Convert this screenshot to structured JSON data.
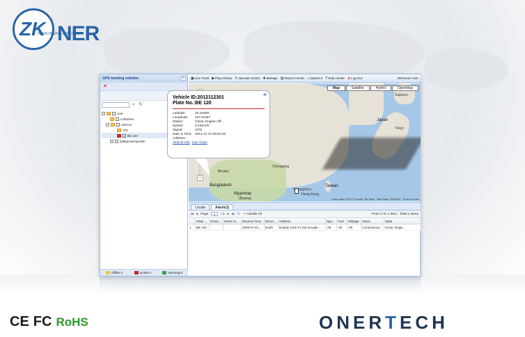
{
  "branding": {
    "logo_zk": "ZK",
    "logo_small": "WWW.ONERALARM.COM",
    "logo_ner": "NER",
    "certs": [
      "CE",
      "FC"
    ],
    "rohs": "RoHS",
    "brand_pre": "ONER",
    "brand_t": "T",
    "brand_post": "ECH"
  },
  "left_panel": {
    "title": "GPS tracking solution",
    "collapse_glyph": "«",
    "delete_glyph": "✕",
    "search_placeholder": "",
    "tree": [
      {
        "label": "oner",
        "level": 0
      },
      {
        "label": "coltracker",
        "level": 1
      },
      {
        "label": "onercar",
        "level": 1
      },
      {
        "label": "123",
        "level": 2
      },
      {
        "label": "BE 120",
        "level": 2
      },
      {
        "label": "ataligrossimporten",
        "level": 1
      }
    ],
    "status": [
      {
        "label": "Offline:1",
        "color": "#f4c542"
      },
      {
        "label": "Online:1",
        "color": "#c8262a"
      },
      {
        "label": "Running:0",
        "color": "#3aa33a"
      }
    ]
  },
  "toolbar": {
    "items": [
      "Live Track",
      "Play History",
      "Operate Centre",
      "Manage",
      "Report Centre",
      "System",
      "Help Center",
      "Log Out"
    ],
    "welcome": "Welcome! oner"
  },
  "map": {
    "tabs": [
      "Map",
      "Satellite",
      "Hybrid",
      "OpenMap"
    ],
    "active_tab": "Map",
    "labels": [
      {
        "text": "Sapporo"
      },
      {
        "text": "Japan"
      },
      {
        "text": "Tokyo"
      },
      {
        "text": "Bhutan"
      },
      {
        "text": "Chongqing"
      },
      {
        "text": "Bangladesh"
      },
      {
        "text": "Myanmar"
      },
      {
        "text": "(Burma)"
      },
      {
        "text": "Taiwan"
      },
      {
        "text": "Hong Kong"
      },
      {
        "text": "Guangzhou"
      }
    ],
    "copyright": "Map data ©2012 Google, SK M&C, Tele Atlas, ZENRIN - Terms of Use",
    "info": {
      "close_glyph": "⊗",
      "vehicle_id": "Vehicle ID:2012112301",
      "plate": "Plate No.:BE 120",
      "rows": [
        {
          "k": "Latitude:",
          "v": "23.16288"
        },
        {
          "k": "Longitude:",
          "v": "113.31187"
        },
        {
          "k": "Status:",
          "v": "Close; Engine Off;"
        },
        {
          "k": "Speed:",
          "v": "0.15Km/h"
        },
        {
          "k": "Signal:",
          "v": "GPS"
        },
        {
          "k": "Date & Time:",
          "v": "2012-11-23 09:54:26"
        },
        {
          "k": "Address:",
          "v": ""
        }
      ],
      "links": [
        "Vehicle Info",
        "Live Track"
      ]
    }
  },
  "bottom": {
    "tabs": [
      "Locate",
      "Alarm(1)"
    ],
    "active_tab": "Alarm(1)",
    "pager": {
      "page_label": "Page",
      "page": "1",
      "of": "/ 1",
      "handle_all": "Handle All",
      "summary": "From 1 To 1 Item , Total 1 Items"
    },
    "columns": [
      "",
      "Plate ...",
      "Driver...",
      "Driver N...",
      "Receive Time",
      "Direct...",
      "Address",
      "Spe...",
      "Fuel",
      "Mileage",
      "Alarm",
      "State"
    ],
    "rows": [
      [
        "1",
        "BE 120",
        "",
        "",
        "2009-07-23 ...",
        "North",
        "Double Click To Get Google ...",
        ".00",
        ".00",
        ".00",
        "Cut External...",
        "Close; Engin..."
      ]
    ]
  }
}
